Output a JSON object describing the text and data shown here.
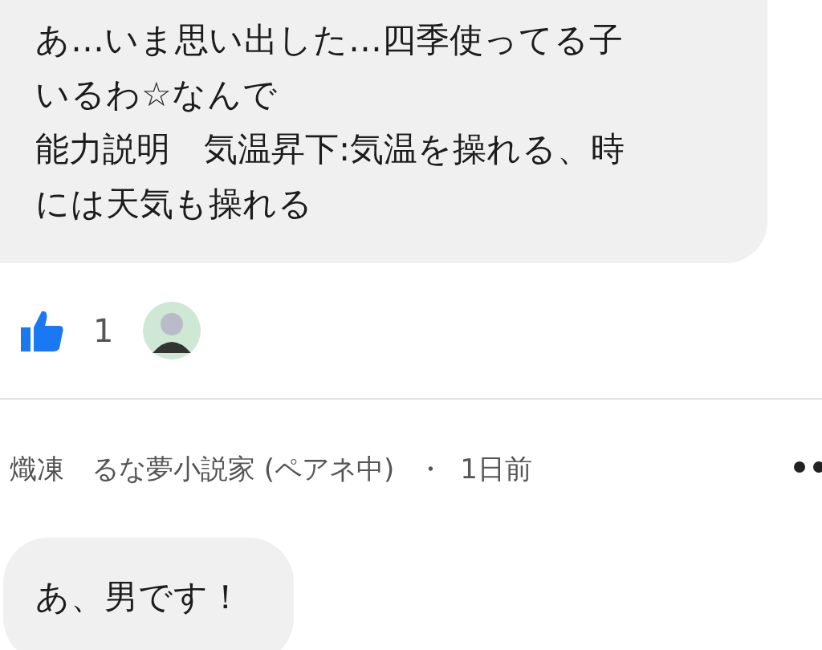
{
  "comments": [
    {
      "paragraphs": [
        "あ…いま思い出した…四季使ってる子いるわ☆なんで",
        "能力説明　気温昇下:気温を操れる、時には天気も操れる"
      ]
    }
  ],
  "reactions": {
    "like_count": "1"
  },
  "reply": {
    "author": "熾凍　るな夢小説家 (ペアネ中)",
    "separator": "・",
    "time": "1日前",
    "text": "あ、男です！"
  }
}
